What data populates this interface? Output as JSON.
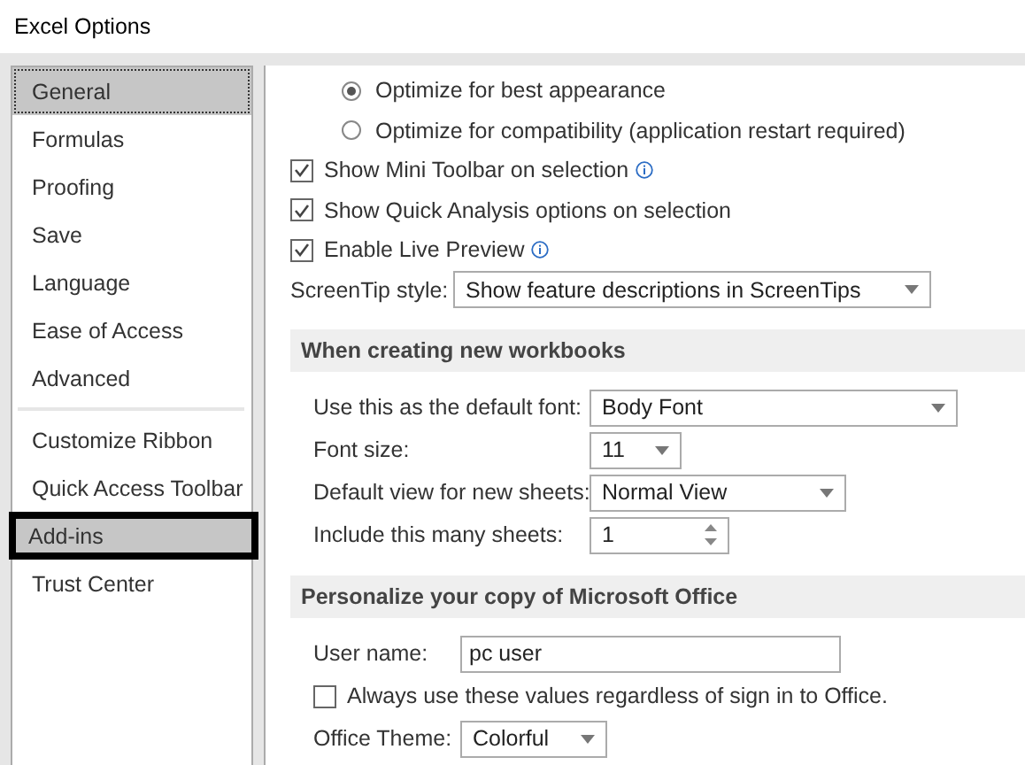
{
  "window": {
    "title": "Excel Options"
  },
  "sidebar": {
    "groups": [
      [
        {
          "label": "General",
          "selected": true,
          "highlighted": false
        },
        {
          "label": "Formulas",
          "selected": false,
          "highlighted": false
        },
        {
          "label": "Proofing",
          "selected": false,
          "highlighted": false
        },
        {
          "label": "Save",
          "selected": false,
          "highlighted": false
        },
        {
          "label": "Language",
          "selected": false,
          "highlighted": false
        },
        {
          "label": "Ease of Access",
          "selected": false,
          "highlighted": false
        },
        {
          "label": "Advanced",
          "selected": false,
          "highlighted": false
        }
      ],
      [
        {
          "label": "Customize Ribbon",
          "selected": false,
          "highlighted": false
        },
        {
          "label": "Quick Access Toolbar",
          "selected": false,
          "highlighted": false
        },
        {
          "label": "Add-ins",
          "selected": false,
          "highlighted": true
        },
        {
          "label": "Trust Center",
          "selected": false,
          "highlighted": false
        }
      ]
    ]
  },
  "top_rows": [
    {
      "kind": "radio",
      "label": "Optimize for best appearance",
      "selected": true
    },
    {
      "kind": "radio",
      "label": "Optimize for compatibility (application restart required)",
      "selected": false
    },
    {
      "kind": "checkbox",
      "label": "Show Mini Toolbar on selection",
      "checked": true,
      "info": true
    },
    {
      "kind": "checkbox",
      "label": "Show Quick Analysis options on selection",
      "checked": true,
      "info": false
    },
    {
      "kind": "checkbox",
      "label": "Enable Live Preview",
      "checked": true,
      "info": true
    },
    {
      "kind": "select",
      "label": "ScreenTip style:",
      "value": "Show feature descriptions in ScreenTips"
    }
  ],
  "sections": [
    {
      "title": "When creating new workbooks",
      "rows": [
        {
          "kind": "select",
          "label": "Use this as the default font:",
          "value": "Body Font"
        },
        {
          "kind": "select",
          "label": "Font size:",
          "value": "11"
        },
        {
          "kind": "select",
          "label": "Default view for new sheets:",
          "value": "Normal View"
        },
        {
          "kind": "spinner",
          "label": "Include this many sheets:",
          "value": "1"
        }
      ]
    },
    {
      "title": "Personalize your copy of Microsoft Office",
      "rows": [
        {
          "kind": "text",
          "label": "User name:",
          "value": "pc user"
        },
        {
          "kind": "checkbox",
          "label": "Always use these values regardless of sign in to Office.",
          "checked": false,
          "info": false
        },
        {
          "kind": "select",
          "label": "Office Theme:",
          "value": "Colorful"
        }
      ]
    }
  ]
}
